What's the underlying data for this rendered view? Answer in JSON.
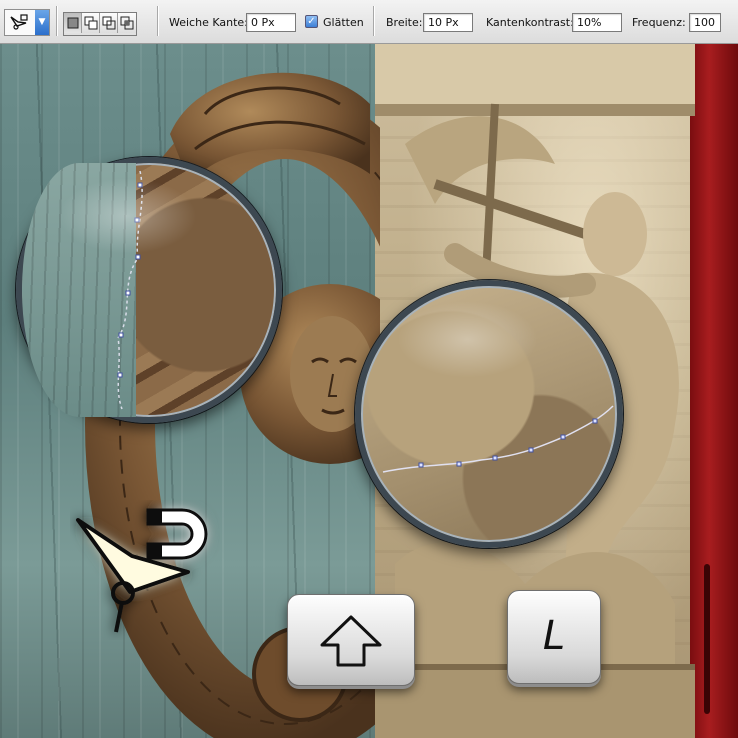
{
  "toolbar": {
    "tool_preset_icon": "magnetic-lasso-icon",
    "selection_modes": [
      {
        "name": "new-selection-icon",
        "active": true
      },
      {
        "name": "add-to-selection-icon",
        "active": false
      },
      {
        "name": "subtract-from-selection-icon",
        "active": false
      },
      {
        "name": "intersect-selection-icon",
        "active": false
      }
    ],
    "feather_label": "Weiche Kante:",
    "feather_value": "0 Px",
    "antialias_label": "Glätten",
    "antialias_checked": true,
    "width_label": "Breite:",
    "width_value": "10 Px",
    "contrast_label": "Kantenkontrast:",
    "contrast_value": "10%",
    "frequency_label": "Frequenz:",
    "frequency_value": "100"
  },
  "keys": {
    "shift_icon": "shift-arrow-icon",
    "l_key": "L"
  },
  "colors": {
    "toolbar_bg": "#dcdcdc",
    "checkbox_blue": "#3d7fd6",
    "lens_rim": "#3d4851",
    "anchor_path": "#4050a0"
  }
}
